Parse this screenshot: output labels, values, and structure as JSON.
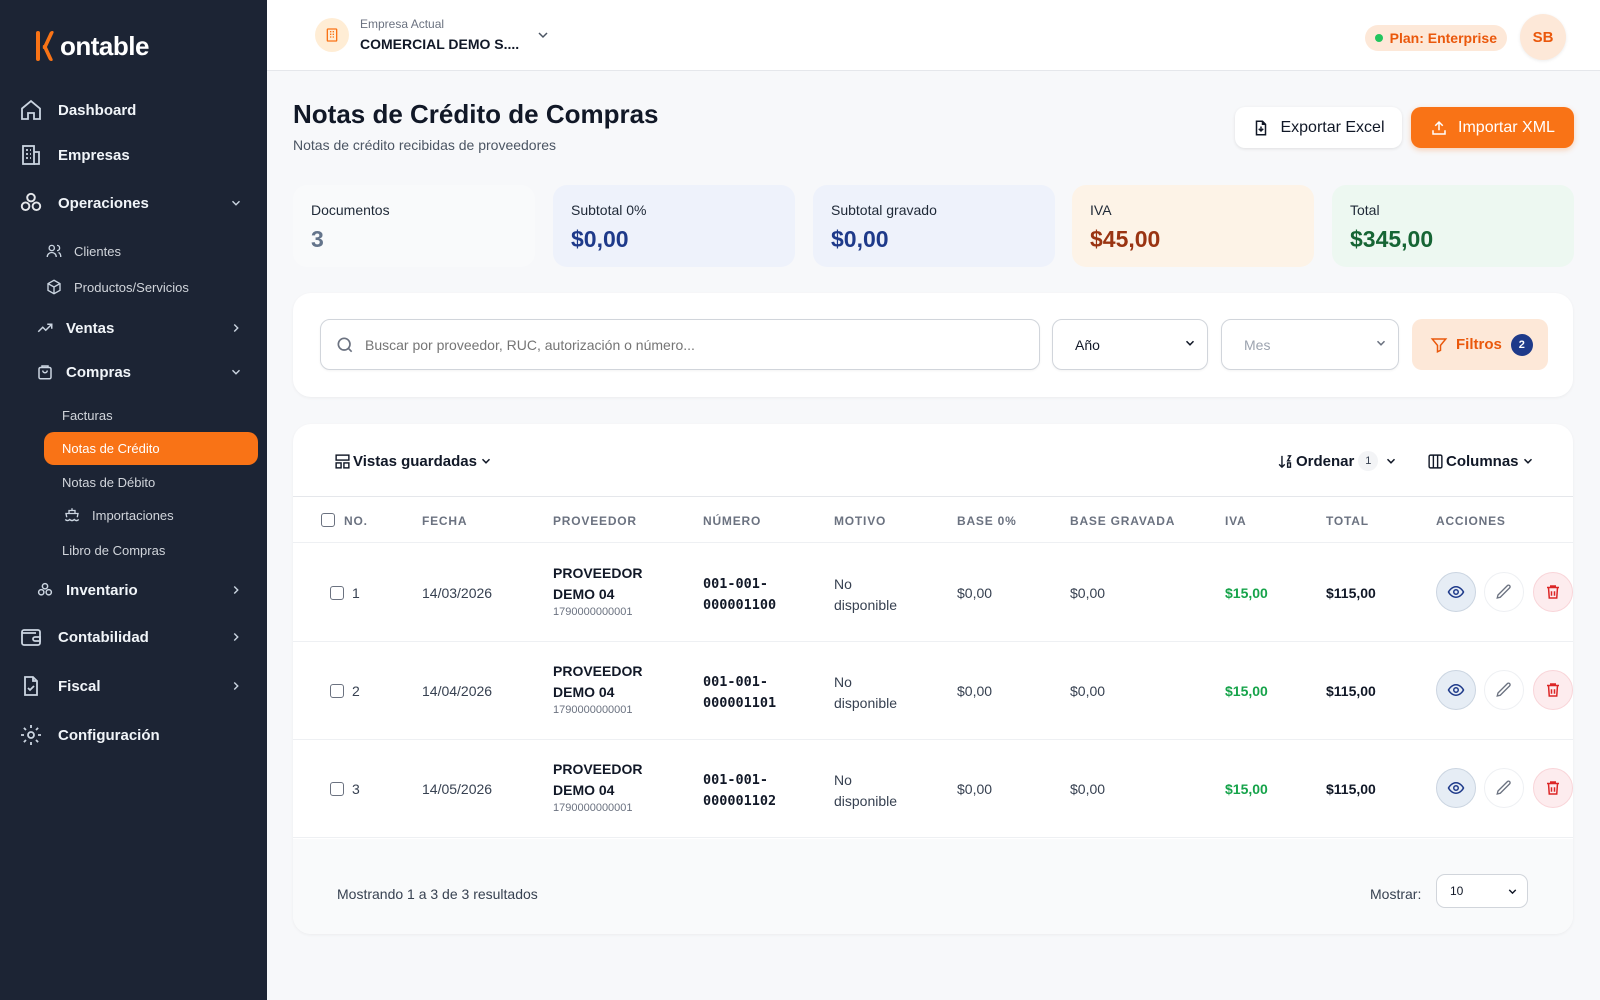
{
  "brand": {
    "logo_text": "ontable",
    "accent": "#f97316"
  },
  "sidebar": {
    "items": [
      {
        "label": "Dashboard",
        "icon": "home-icon"
      },
      {
        "label": "Empresas",
        "icon": "building-icon"
      },
      {
        "label": "Operaciones",
        "icon": "boxes-icon",
        "expanded": true
      },
      {
        "label": "Clientes",
        "icon": "users-icon"
      },
      {
        "label": "Productos/Servicios",
        "icon": "package-icon"
      },
      {
        "label": "Ventas",
        "icon": "trending-up-icon"
      },
      {
        "label": "Compras",
        "icon": "shopping-bag-icon",
        "expanded": true
      },
      {
        "label": "Facturas"
      },
      {
        "label": "Notas de Crédito",
        "active": true
      },
      {
        "label": "Notas de Débito"
      },
      {
        "label": "Importaciones",
        "icon": "ship-icon"
      },
      {
        "label": "Libro de Compras"
      },
      {
        "label": "Inventario",
        "icon": "boxes-icon"
      },
      {
        "label": "Contabilidad",
        "icon": "wallet-icon"
      },
      {
        "label": "Fiscal",
        "icon": "file-check-icon"
      },
      {
        "label": "Configuración",
        "icon": "gear-icon"
      }
    ]
  },
  "header": {
    "company_label": "Empresa Actual",
    "company_name": "COMERCIAL DEMO S....",
    "plan": "Plan: Enterprise",
    "avatar": "SB"
  },
  "page": {
    "title": "Notas de Crédito de Compras",
    "subtitle": "Notas de crédito recibidas de proveedores",
    "export_label": "Exportar Excel",
    "import_label": "Importar XML"
  },
  "stats": [
    {
      "label": "Documentos",
      "value": "3",
      "color": "#64748b",
      "bg": "#f9fafb"
    },
    {
      "label": "Subtotal 0%",
      "value": "$0,00",
      "color": "#1e3a8a",
      "bg": "#eef2fb"
    },
    {
      "label": "Subtotal gravado",
      "value": "$0,00",
      "color": "#1e3a8a",
      "bg": "#eef2fb"
    },
    {
      "label": "IVA",
      "value": "$45,00",
      "color": "#9a3412",
      "bg": "#fdf3e7"
    },
    {
      "label": "Total",
      "value": "$345,00",
      "color": "#166534",
      "bg": "#edf8f1"
    }
  ],
  "filters": {
    "search_placeholder": "Buscar por proveedor, RUC, autorización o número...",
    "year_label": "Año",
    "month_label": "Mes",
    "filters_label": "Filtros",
    "filters_count": "2"
  },
  "toolbar": {
    "views_label": "Vistas guardadas",
    "sort_label": "Ordenar",
    "sort_count": "1",
    "columns_label": "Columnas"
  },
  "table": {
    "headers": [
      "NO.",
      "FECHA",
      "PROVEEDOR",
      "NÚMERO",
      "MOTIVO",
      "BASE 0%",
      "BASE GRAVADA",
      "IVA",
      "TOTAL",
      "ACCIONES"
    ],
    "rows": [
      {
        "no": "1",
        "fecha": "14/03/2026",
        "proveedor": "PROVEEDOR DEMO 04",
        "prov1": "PROVEEDOR",
        "prov2": "DEMO 04",
        "ruc": "1790000000001",
        "num1": "001-001-",
        "num2": "000001100",
        "mot1": "No",
        "mot2": "disponible",
        "base0": "$0,00",
        "basegrav": "$0,00",
        "iva": "$15,00",
        "total": "$115,00"
      },
      {
        "no": "2",
        "fecha": "14/04/2026",
        "proveedor": "PROVEEDOR DEMO 04",
        "prov1": "PROVEEDOR",
        "prov2": "DEMO 04",
        "ruc": "1790000000001",
        "num1": "001-001-",
        "num2": "000001101",
        "mot1": "No",
        "mot2": "disponible",
        "base0": "$0,00",
        "basegrav": "$0,00",
        "iva": "$15,00",
        "total": "$115,00"
      },
      {
        "no": "3",
        "fecha": "14/05/2026",
        "proveedor": "PROVEEDOR DEMO 04",
        "prov1": "PROVEEDOR",
        "prov2": "DEMO 04",
        "ruc": "1790000000001",
        "num1": "001-001-",
        "num2": "000001102",
        "mot1": "No",
        "mot2": "disponible",
        "base0": "$0,00",
        "basegrav": "$0,00",
        "iva": "$15,00",
        "total": "$115,00"
      }
    ]
  },
  "pagination": {
    "showing": "Mostrando 1 a 3 de 3 resultados",
    "show_label": "Mostrar:",
    "page_size": "10"
  }
}
